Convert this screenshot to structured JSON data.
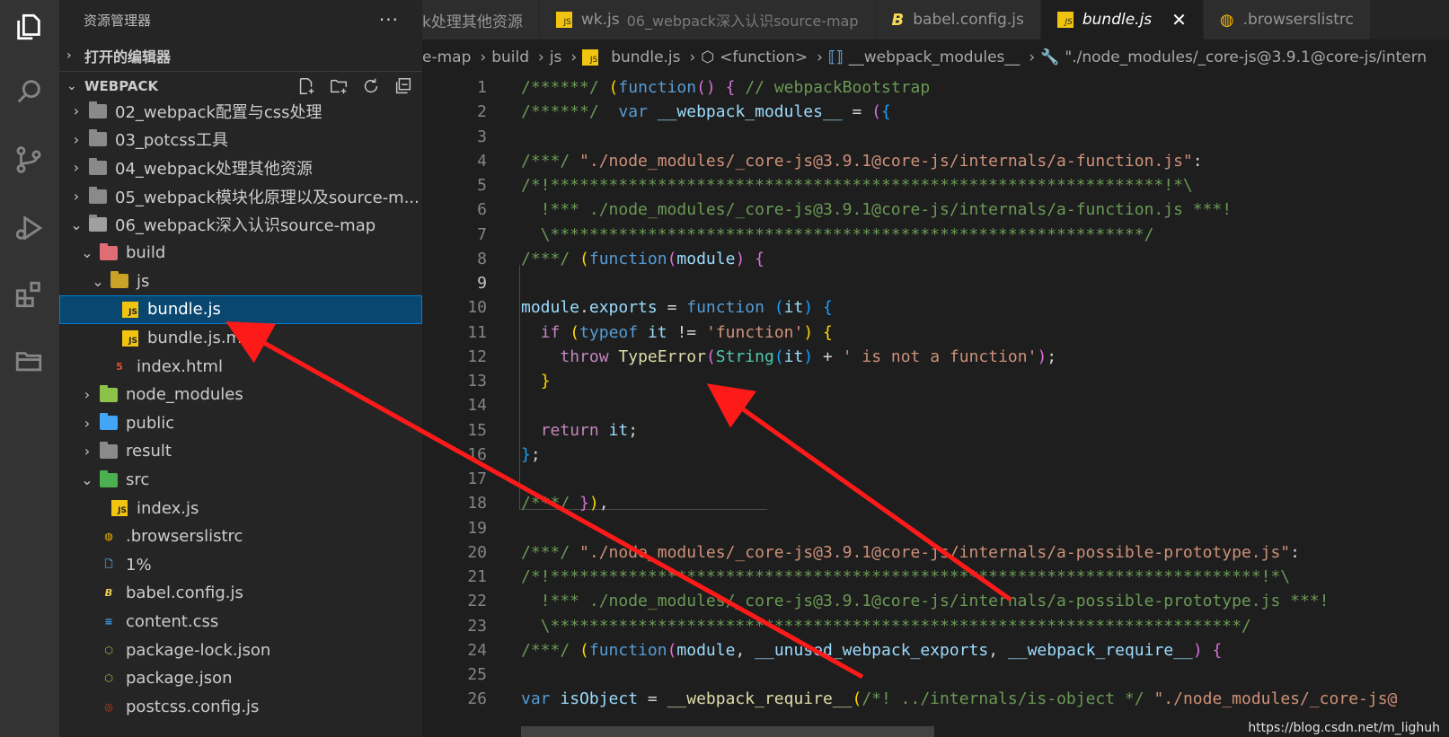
{
  "sidebar": {
    "title": "资源管理器",
    "more": "···",
    "open_editors": "打开的编辑器",
    "workspace": "WEBPACK",
    "tree": [
      {
        "label": "02_webpack配置与css处理",
        "indent": 1,
        "twisty": "›",
        "icon": "folder"
      },
      {
        "label": "03_potcss工具",
        "indent": 1,
        "twisty": "›",
        "icon": "folder"
      },
      {
        "label": "04_webpack处理其他资源",
        "indent": 1,
        "twisty": "›",
        "icon": "folder"
      },
      {
        "label": "05_webpack模块化原理以及source-m...",
        "indent": 1,
        "twisty": "›",
        "icon": "folder"
      },
      {
        "label": "06_webpack深入认识source-map",
        "indent": 1,
        "twisty": "⌄",
        "icon": "folder-open"
      },
      {
        "label": "build",
        "indent": 2,
        "twisty": "⌄",
        "icon": "folder-red"
      },
      {
        "label": "js",
        "indent": 3,
        "twisty": "⌄",
        "icon": "folder-yellow"
      },
      {
        "label": "bundle.js",
        "indent": 4,
        "twisty": "",
        "icon": "js",
        "selected": true
      },
      {
        "label": "bundle.js.map",
        "indent": 4,
        "twisty": "",
        "icon": "js"
      },
      {
        "label": "index.html",
        "indent": 3,
        "twisty": "",
        "icon": "html"
      },
      {
        "label": "node_modules",
        "indent": 2,
        "twisty": "›",
        "icon": "folder-green"
      },
      {
        "label": "public",
        "indent": 2,
        "twisty": "›",
        "icon": "folder-blue"
      },
      {
        "label": "result",
        "indent": 2,
        "twisty": "›",
        "icon": "folder"
      },
      {
        "label": "src",
        "indent": 2,
        "twisty": "⌄",
        "icon": "folder-teal"
      },
      {
        "label": "index.js",
        "indent": 3,
        "twisty": "",
        "icon": "js"
      },
      {
        "label": ".browserslistrc",
        "indent": 2,
        "twisty": "",
        "icon": "browserslist"
      },
      {
        "label": "1%",
        "indent": 2,
        "twisty": "",
        "icon": "file"
      },
      {
        "label": "babel.config.js",
        "indent": 2,
        "twisty": "",
        "icon": "babel"
      },
      {
        "label": "content.css",
        "indent": 2,
        "twisty": "",
        "icon": "css"
      },
      {
        "label": "package-lock.json",
        "indent": 2,
        "twisty": "",
        "icon": "node"
      },
      {
        "label": "package.json",
        "indent": 2,
        "twisty": "",
        "icon": "node"
      },
      {
        "label": "postcss.config.js",
        "indent": 2,
        "twisty": "",
        "icon": "postcss"
      }
    ]
  },
  "tabs": [
    {
      "label": "k处理其他资源",
      "sub": "",
      "icon": "none"
    },
    {
      "label": "wk.js",
      "sub": "06_webpack深入认识source-map",
      "icon": "js"
    },
    {
      "label": "babel.config.js",
      "sub": "",
      "icon": "babel"
    },
    {
      "label": "bundle.js",
      "sub": "",
      "icon": "js",
      "active": true,
      "close": "✕"
    },
    {
      "label": ".browserslistrc",
      "sub": "",
      "icon": "browserslist"
    }
  ],
  "breadcrumb": [
    "e-map",
    "build",
    "js",
    "bundle.js",
    "<function>",
    "__webpack_modules__",
    "\"./node_modules/_core-js@3.9.1@core-js/intern"
  ],
  "code": {
    "current_line": 9,
    "lines": [
      {
        "n": "1",
        "t": [
          [
            "c-cm",
            "/******/ "
          ],
          [
            "c-b1",
            "("
          ],
          [
            "c-kw",
            "function"
          ],
          [
            "c-b2",
            "()"
          ],
          [
            "c-p",
            " "
          ],
          [
            "c-b2",
            "{"
          ],
          [
            "c-p",
            " "
          ],
          [
            "c-cm",
            "// webpackBootstrap"
          ]
        ]
      },
      {
        "n": "2",
        "t": [
          [
            "c-cm",
            "/******/ "
          ],
          [
            "c-p",
            " "
          ],
          [
            "c-kw",
            "var"
          ],
          [
            "c-p",
            " "
          ],
          [
            "c-var",
            "__webpack_modules__"
          ],
          [
            "c-p",
            " = "
          ],
          [
            "c-b2",
            "("
          ],
          [
            "c-b3",
            "{"
          ]
        ]
      },
      {
        "n": "3",
        "t": []
      },
      {
        "n": "4",
        "t": [
          [
            "c-cm",
            "/***/ "
          ],
          [
            "c-str",
            "\"./node_modules/_core-js@3.9.1@core-js/internals/a-function.js\""
          ],
          [
            "c-p",
            ":"
          ]
        ]
      },
      {
        "n": "5",
        "t": [
          [
            "c-cm",
            "/*!***************************************************************!*\\"
          ]
        ]
      },
      {
        "n": "6",
        "t": [
          [
            "c-cm",
            "  !*** ./node_modules/_core-js@3.9.1@core-js/internals/a-function.js ***!"
          ]
        ]
      },
      {
        "n": "7",
        "t": [
          [
            "c-cm",
            "  \\*************************************************************/"
          ]
        ]
      },
      {
        "n": "8",
        "t": [
          [
            "c-cm",
            "/***/ "
          ],
          [
            "c-b1",
            "("
          ],
          [
            "c-kw",
            "function"
          ],
          [
            "c-b2",
            "("
          ],
          [
            "c-var",
            "module"
          ],
          [
            "c-b2",
            ")"
          ],
          [
            "c-p",
            " "
          ],
          [
            "c-b2",
            "{"
          ]
        ]
      },
      {
        "n": "9",
        "t": []
      },
      {
        "n": "10",
        "t": [
          [
            "c-var",
            "module"
          ],
          [
            "c-p",
            "."
          ],
          [
            "c-var",
            "exports"
          ],
          [
            "c-p",
            " = "
          ],
          [
            "c-kw",
            "function"
          ],
          [
            "c-p",
            " "
          ],
          [
            "c-b3",
            "("
          ],
          [
            "c-var",
            "it"
          ],
          [
            "c-b3",
            ")"
          ],
          [
            "c-p",
            " "
          ],
          [
            "c-b3",
            "{"
          ]
        ]
      },
      {
        "n": "11",
        "t": [
          [
            "c-p",
            "  "
          ],
          [
            "c-kw2",
            "if"
          ],
          [
            "c-p",
            " "
          ],
          [
            "c-b1",
            "("
          ],
          [
            "c-kw",
            "typeof"
          ],
          [
            "c-p",
            " "
          ],
          [
            "c-var",
            "it"
          ],
          [
            "c-p",
            " != "
          ],
          [
            "c-str",
            "'function'"
          ],
          [
            "c-b1",
            ")"
          ],
          [
            "c-p",
            " "
          ],
          [
            "c-b1",
            "{"
          ]
        ]
      },
      {
        "n": "12",
        "t": [
          [
            "c-p",
            "    "
          ],
          [
            "c-kw2",
            "throw"
          ],
          [
            "c-p",
            " "
          ],
          [
            "c-fn",
            "TypeError"
          ],
          [
            "c-b2",
            "("
          ],
          [
            "c-ty",
            "String"
          ],
          [
            "c-b3",
            "("
          ],
          [
            "c-var",
            "it"
          ],
          [
            "c-b3",
            ")"
          ],
          [
            "c-p",
            " + "
          ],
          [
            "c-str",
            "' is not a function'"
          ],
          [
            "c-b2",
            ")"
          ],
          [
            "c-p",
            ";"
          ]
        ]
      },
      {
        "n": "13",
        "t": [
          [
            "c-p",
            "  "
          ],
          [
            "c-b1",
            "}"
          ]
        ]
      },
      {
        "n": "14",
        "t": []
      },
      {
        "n": "15",
        "t": [
          [
            "c-p",
            "  "
          ],
          [
            "c-kw2",
            "return"
          ],
          [
            "c-p",
            " "
          ],
          [
            "c-var",
            "it"
          ],
          [
            "c-p",
            ";"
          ]
        ]
      },
      {
        "n": "16",
        "t": [
          [
            "c-b3",
            "}"
          ],
          [
            "c-p",
            ";"
          ]
        ]
      },
      {
        "n": "17",
        "t": []
      },
      {
        "n": "18",
        "t": [
          [
            "c-cm",
            "/***/ "
          ],
          [
            "c-b2",
            "}"
          ],
          [
            "c-b1",
            ")"
          ],
          [
            "c-p",
            ","
          ]
        ]
      },
      {
        "n": "19",
        "t": []
      },
      {
        "n": "20",
        "t": [
          [
            "c-cm",
            "/***/ "
          ],
          [
            "c-str",
            "\"./node_modules/_core-js@3.9.1@core-js/internals/a-possible-prototype.js\""
          ],
          [
            "c-p",
            ":"
          ]
        ]
      },
      {
        "n": "21",
        "t": [
          [
            "c-cm",
            "/*!*************************************************************************!*\\"
          ]
        ]
      },
      {
        "n": "22",
        "t": [
          [
            "c-cm",
            "  !*** ./node_modules/_core-js@3.9.1@core-js/internals/a-possible-prototype.js ***!"
          ]
        ]
      },
      {
        "n": "23",
        "t": [
          [
            "c-cm",
            "  \\***********************************************************************/"
          ]
        ]
      },
      {
        "n": "24",
        "t": [
          [
            "c-cm",
            "/***/ "
          ],
          [
            "c-b1",
            "("
          ],
          [
            "c-kw",
            "function"
          ],
          [
            "c-b2",
            "("
          ],
          [
            "c-var",
            "module"
          ],
          [
            "c-p",
            ", "
          ],
          [
            "c-var",
            "__unused_webpack_exports"
          ],
          [
            "c-p",
            ", "
          ],
          [
            "c-var",
            "__webpack_require__"
          ],
          [
            "c-b2",
            ")"
          ],
          [
            "c-p",
            " "
          ],
          [
            "c-b2",
            "{"
          ]
        ]
      },
      {
        "n": "25",
        "t": []
      },
      {
        "n": "26",
        "t": [
          [
            "c-kw",
            "var"
          ],
          [
            "c-p",
            " "
          ],
          [
            "c-var",
            "isObject"
          ],
          [
            "c-p",
            " = "
          ],
          [
            "c-fn",
            "__webpack_require__"
          ],
          [
            "c-b1",
            "("
          ],
          [
            "c-cm",
            "/*! ../internals/is-object */"
          ],
          [
            "c-p",
            " "
          ],
          [
            "c-str",
            "\"./node_modules/_core-js@"
          ]
        ]
      }
    ]
  },
  "watermark": "https://blog.csdn.net/m_lighuh",
  "colors": {
    "selection": "#094771",
    "arrow": "#ff1a1a",
    "accent": "#007fd4"
  }
}
